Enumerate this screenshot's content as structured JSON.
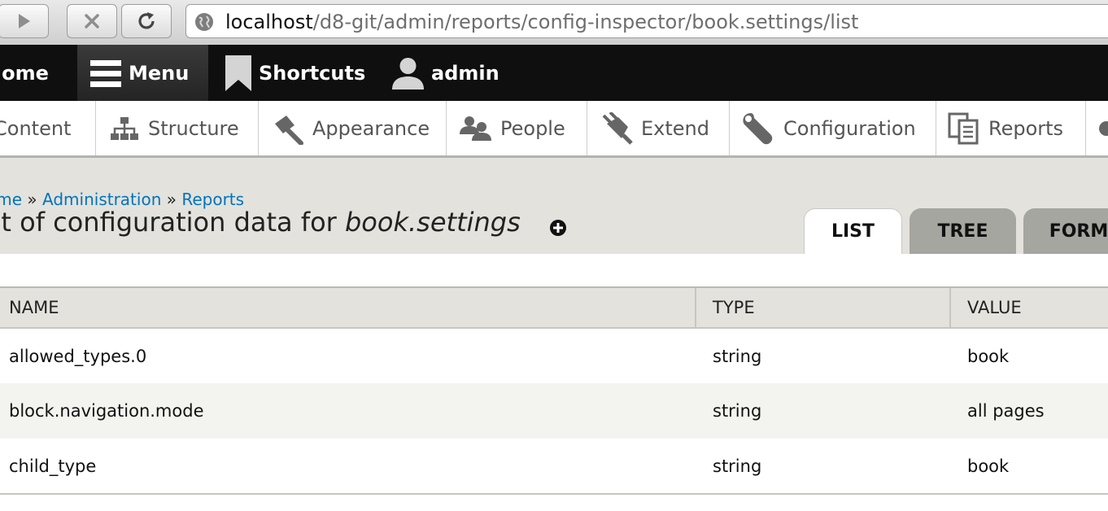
{
  "browser": {
    "url_host": "localhost",
    "url_path": "/d8-git/admin/reports/config-inspector/book.settings/list"
  },
  "toolbar": {
    "home_label": "Home",
    "menu_label": "Menu",
    "shortcuts_label": "Shortcuts",
    "user_label": "admin"
  },
  "tray": {
    "items": [
      {
        "label": "Content",
        "icon": "content-icon"
      },
      {
        "label": "Structure",
        "icon": "structure-icon"
      },
      {
        "label": "Appearance",
        "icon": "appearance-icon"
      },
      {
        "label": "People",
        "icon": "people-icon"
      },
      {
        "label": "Extend",
        "icon": "extend-icon"
      },
      {
        "label": "Configuration",
        "icon": "wrench-icon"
      },
      {
        "label": "Reports",
        "icon": "reports-icon"
      }
    ]
  },
  "breadcrumb": {
    "home": "Home",
    "sep": " » ",
    "admin": "Administration",
    "reports": "Reports"
  },
  "page": {
    "title_prefix": "List of configuration data for ",
    "title_name": "book.settings"
  },
  "tabs": [
    "LIST",
    "TREE",
    "FORM"
  ],
  "table": {
    "headers": [
      "NAME",
      "TYPE",
      "VALUE"
    ],
    "rows": [
      [
        "allowed_types.0",
        "string",
        "book"
      ],
      [
        "block.navigation.mode",
        "string",
        "all pages"
      ],
      [
        "child_type",
        "string",
        "book"
      ]
    ]
  }
}
